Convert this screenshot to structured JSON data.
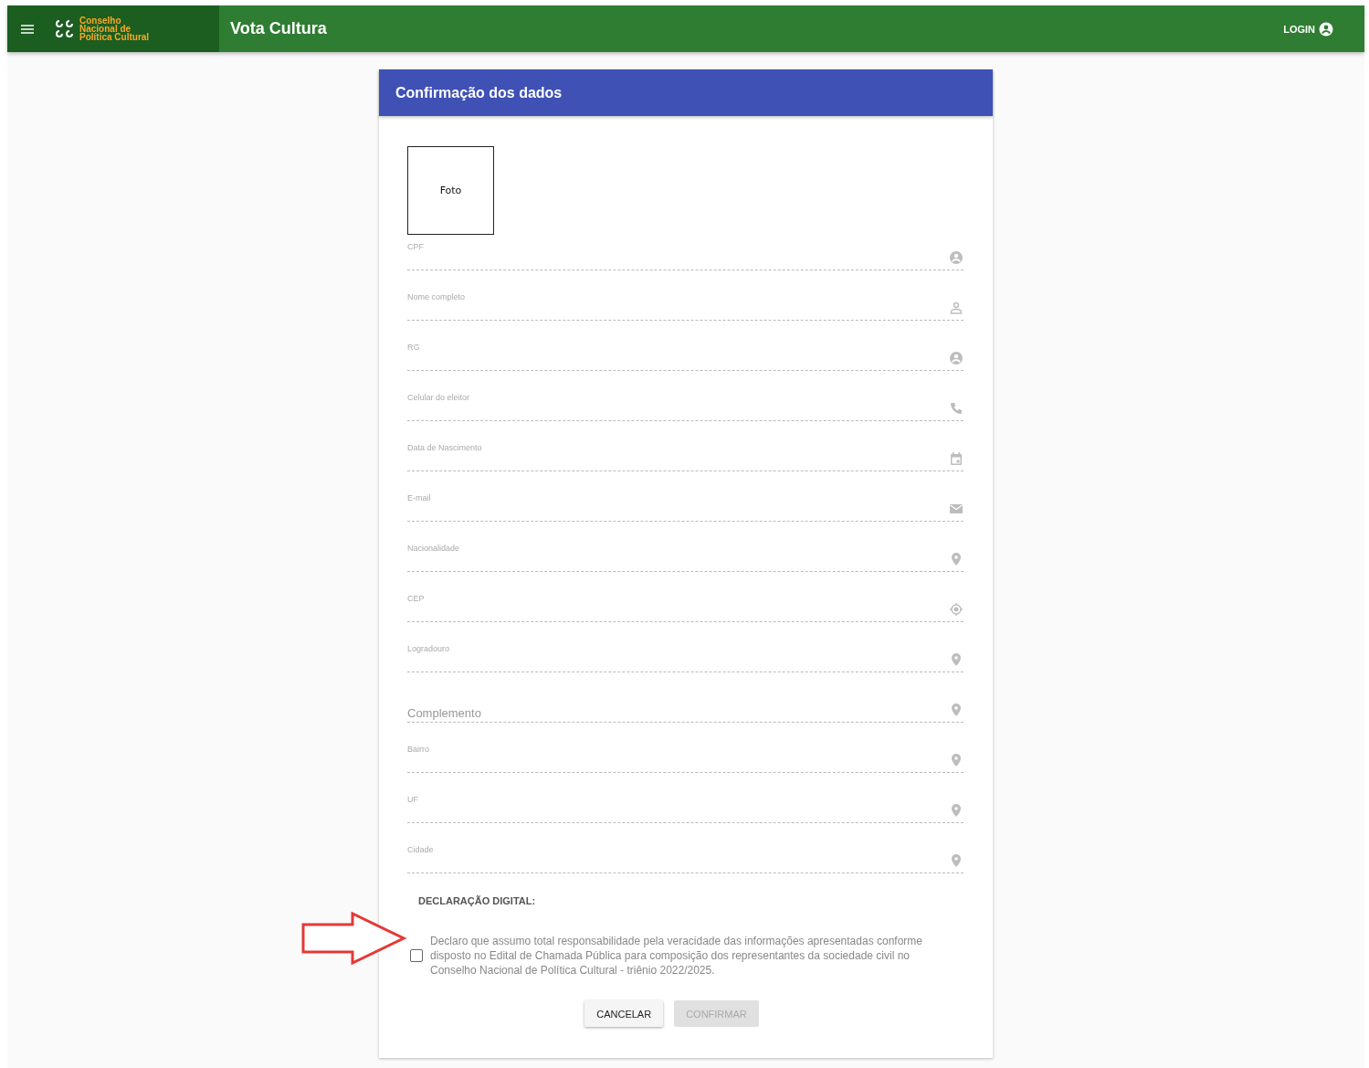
{
  "app_bar": {
    "logo_lines": [
      "Conselho",
      "Nacional de",
      "Política Cultural"
    ],
    "title": "Vota Cultura",
    "login": "LOGIN"
  },
  "card": {
    "title": "Confirmação dos dados",
    "photo": "Foto",
    "fields": [
      {
        "kind": "floating",
        "label": "CPF"
      },
      {
        "kind": "floating",
        "label": "Nome completo"
      },
      {
        "kind": "floating",
        "label": "RG"
      },
      {
        "kind": "floating",
        "label": "Celular do eleitor"
      },
      {
        "kind": "floating",
        "label": "Data de Nascimento"
      },
      {
        "kind": "floating",
        "label": "E-mail"
      },
      {
        "kind": "floating",
        "label": "Nacionalidade"
      },
      {
        "kind": "floating",
        "label": "CEP"
      },
      {
        "kind": "floating",
        "label": "Logradouro"
      },
      {
        "kind": "placeholder",
        "placeholder": "Complemento"
      },
      {
        "kind": "floating",
        "label": "Bairro"
      },
      {
        "kind": "floating",
        "label": "UF"
      },
      {
        "kind": "floating",
        "label": "Cidade"
      }
    ],
    "declaration_title": "DECLARAÇÃO DIGITAL:",
    "declaration": {
      "checked": false,
      "text": "Declaro que assumo total responsabilidade pela veracidade das informações apresentadas conforme disposto no Edital de Chamada Pública para composição dos representantes da sociedade civil no Conselho Nacional de Política Cultural - triênio 2022/2025."
    },
    "buttons": [
      {
        "label": "CANCELAR",
        "disabled": false
      },
      {
        "label": "CONFIRMAR",
        "disabled": true
      }
    ]
  }
}
